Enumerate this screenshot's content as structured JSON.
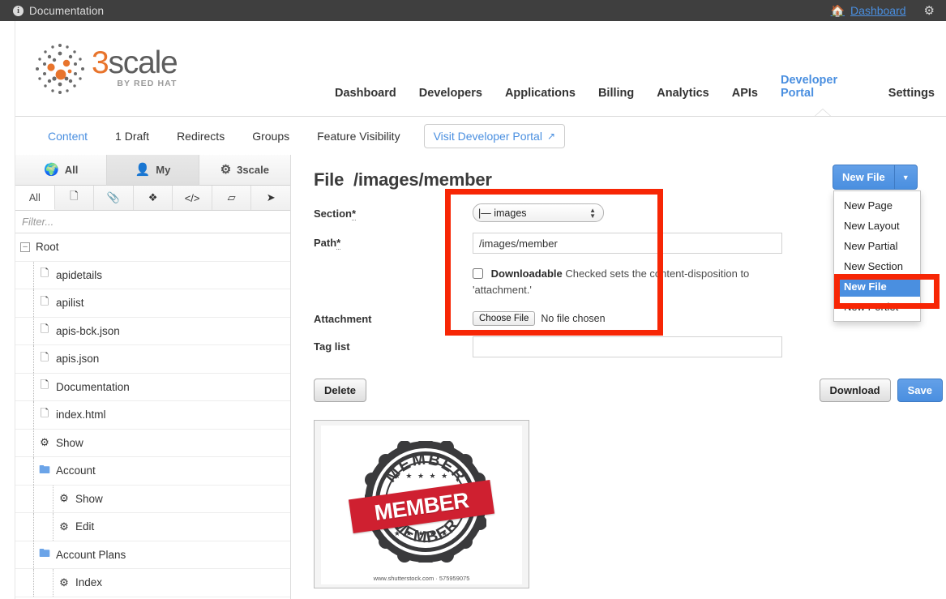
{
  "topbar": {
    "info_icon": "info-icon",
    "doc_label": "Documentation",
    "dashboard_label": "Dashboard",
    "home_icon": "home-icon",
    "gear_icon": "gear-icon",
    "link_color": "#4a8fe0",
    "bg_color": "#3f3f3f"
  },
  "brand": {
    "word_three": "3",
    "word_scale": "scale",
    "tagline": "BY RED HAT",
    "orange": "#e8742c",
    "grey": "#5d5d5d"
  },
  "mainnav": {
    "items": [
      {
        "label": "Dashboard",
        "active": false
      },
      {
        "label": "Developers",
        "active": false
      },
      {
        "label": "Applications",
        "active": false
      },
      {
        "label": "Billing",
        "active": false
      },
      {
        "label": "Analytics",
        "active": false
      },
      {
        "label": "APIs",
        "active": false
      },
      {
        "label": "Developer Portal",
        "active": true
      },
      {
        "label": "Settings",
        "active": false
      }
    ]
  },
  "subnav": {
    "items": [
      {
        "label": "Content",
        "style": "link"
      },
      {
        "label": "1 Draft",
        "style": "plain"
      },
      {
        "label": "Redirects",
        "style": "plain"
      },
      {
        "label": "Groups",
        "style": "plain"
      },
      {
        "label": "Feature Visibility",
        "style": "plain"
      }
    ],
    "visit_button": "Visit Developer Portal",
    "visit_icon": "external-link-icon"
  },
  "sidebar": {
    "scope_tabs": [
      {
        "label": "All",
        "icon": "globe-icon",
        "glyph": "🌐",
        "active": false
      },
      {
        "label": "My",
        "icon": "person-icon",
        "glyph": "👤",
        "active": true
      },
      {
        "label": "3scale",
        "icon": "gear-icon",
        "glyph": "⚙",
        "active": false
      }
    ],
    "type_filters": [
      {
        "label": "All",
        "icon": "all-filter",
        "active": true
      },
      {
        "label": "",
        "icon": "page-icon",
        "glyph": "🗋",
        "active": false
      },
      {
        "label": "",
        "icon": "paperclip-icon",
        "glyph": "📎",
        "active": false
      },
      {
        "label": "",
        "icon": "puzzle-piece-icon",
        "glyph": "❖",
        "active": false
      },
      {
        "label": "",
        "icon": "code-icon",
        "glyph": "‹›",
        "active": false
      },
      {
        "label": "",
        "icon": "folder-icon",
        "glyph": "▱",
        "active": false
      },
      {
        "label": "",
        "icon": "rocket-icon",
        "glyph": "➤",
        "active": false
      }
    ],
    "filter_placeholder": "Filter...",
    "filter_value": "",
    "tree": [
      {
        "label": "Root",
        "level": 0,
        "icon": "collapse-toggle",
        "expanded": true
      },
      {
        "label": "apidetails",
        "level": 1,
        "icon": "doc-icon"
      },
      {
        "label": "apilist",
        "level": 1,
        "icon": "doc-icon"
      },
      {
        "label": "apis-bck.json",
        "level": 1,
        "icon": "doc-icon"
      },
      {
        "label": "apis.json",
        "level": 1,
        "icon": "doc-icon"
      },
      {
        "label": "Documentation",
        "level": 1,
        "icon": "doc-icon"
      },
      {
        "label": "index.html",
        "level": 1,
        "icon": "doc-icon"
      },
      {
        "label": "Show",
        "level": 1,
        "icon": "gear-icon"
      },
      {
        "label": "Account",
        "level": 1,
        "icon": "folder-icon"
      },
      {
        "label": "Show",
        "level": 2,
        "icon": "gear-icon"
      },
      {
        "label": "Edit",
        "level": 2,
        "icon": "gear-icon"
      },
      {
        "label": "Account Plans",
        "level": 1,
        "icon": "folder-icon"
      },
      {
        "label": "Index",
        "level": 2,
        "icon": "gear-icon"
      }
    ]
  },
  "main": {
    "title_prefix": "File",
    "title_path": "/images/member",
    "form": {
      "section": {
        "label": "Section",
        "required_marker": "*",
        "selected": "|— images",
        "options": [
          "|— images"
        ]
      },
      "path": {
        "label": "Path",
        "required_marker": "*",
        "value": "/images/member",
        "placeholder": ""
      },
      "downloadable": {
        "label": "Downloadable",
        "checked": false,
        "help": "Checked sets the content-disposition to 'attachment.'"
      },
      "attachment": {
        "label": "Attachment",
        "choose_label": "Choose File",
        "status": "No file chosen"
      },
      "tag_list": {
        "label": "Tag list",
        "value": "",
        "placeholder": ""
      }
    },
    "buttons": {
      "delete": "Delete",
      "download": "Download",
      "save": "Save"
    },
    "preview": {
      "stamp_arc_top": "MEMBER",
      "stamp_arc_bottom": "MEMBER",
      "ribbon_text": "MEMBER",
      "watermark": "shutterstock",
      "caption": "www.shutterstock.com  ·  575959075",
      "stars": "★ ★ ★ ★ ★",
      "ribbon_color": "#cf2030",
      "stamp_color": "#3a3a3c"
    }
  },
  "newfile": {
    "button_label": "New File",
    "caret_icon": "chevron-down-icon",
    "menu": [
      {
        "label": "New Page",
        "active": false
      },
      {
        "label": "New Layout",
        "active": false
      },
      {
        "label": "New Partial",
        "active": false
      },
      {
        "label": "New Section",
        "active": false
      },
      {
        "label": "New File",
        "active": true
      },
      {
        "label": "New Portlet",
        "active": false
      }
    ]
  },
  "annotations": {
    "color": "#f72605",
    "boxes": [
      {
        "name": "form-fields-highlight"
      },
      {
        "name": "new-file-menu-highlight"
      }
    ]
  }
}
